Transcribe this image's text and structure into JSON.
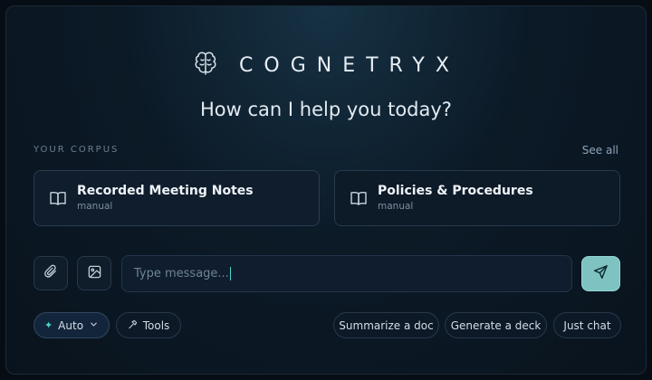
{
  "brand": {
    "name": "COGNETRYX",
    "logo_icon": "brain-icon"
  },
  "greeting": "How can I help you today?",
  "corpus": {
    "title": "YOUR CORPUS",
    "see_all": "See all",
    "items": [
      {
        "title": "Recorded Meeting Notes",
        "subtitle": "manual",
        "icon": "book-icon"
      },
      {
        "title": "Policies & Procedures",
        "subtitle": "manual",
        "icon": "book-icon"
      }
    ]
  },
  "composer": {
    "placeholder": "Type message...",
    "attach_icon": "paperclip-icon",
    "image_icon": "image-icon",
    "send_icon": "send-icon"
  },
  "toolbar": {
    "mode_label": "Auto",
    "tools_label": "Tools",
    "quick_actions": [
      "Summarize a doc",
      "Generate a deck",
      "Just chat"
    ]
  },
  "colors": {
    "accent": "#7ec3c1",
    "caret": "#55d6cf",
    "background": "#0c1a27",
    "border": "#27384a"
  }
}
